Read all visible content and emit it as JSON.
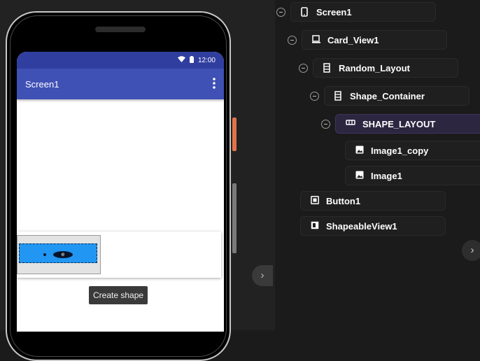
{
  "phone": {
    "status_time": "12:00",
    "app_title": "Screen1",
    "create_shape_label": "Create shape",
    "shape_label": "e"
  },
  "tree": {
    "nodes": [
      {
        "label": "Screen1",
        "icon": "phone-icon"
      },
      {
        "label": "Card_View1",
        "icon": "card-icon"
      },
      {
        "label": "Random_Layout",
        "icon": "vertical-layout-icon"
      },
      {
        "label": "Shape_Container",
        "icon": "vertical-layout-icon"
      },
      {
        "label": "SHAPE_LAYOUT",
        "icon": "horizontal-layout-icon"
      },
      {
        "label": "Image1_copy",
        "icon": "image-icon"
      },
      {
        "label": "Image1",
        "icon": "image-icon"
      },
      {
        "label": "Button1",
        "icon": "button-icon"
      },
      {
        "label": "ShapeableView1",
        "icon": "shapeable-view-icon"
      }
    ]
  },
  "colors": {
    "status_bar": "#303f9f",
    "app_bar": "#3f51b5",
    "shape_fill": "#2196f3",
    "selected_node": "#2c2640",
    "orange_button": "#e0734a"
  }
}
